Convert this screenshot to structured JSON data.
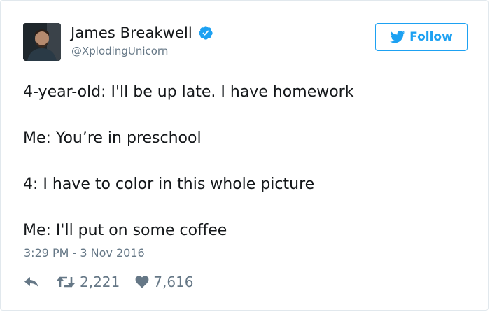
{
  "user": {
    "name": "James Breakwell",
    "handle": "@XplodingUnicorn",
    "verified": true
  },
  "follow_button": {
    "label": "Follow"
  },
  "tweet": {
    "lines": [
      "4-year-old: I'll be up late. I have homework",
      "Me: You’re in preschool",
      "4: I have to color in this whole picture",
      "Me: I'll put on some coffee"
    ],
    "timestamp": "3:29 PM - 3 Nov 2016"
  },
  "actions": {
    "retweets": "2,221",
    "likes": "7,616"
  },
  "colors": {
    "brand_blue": "#1da1f2",
    "text_primary": "#14171a",
    "text_secondary": "#657786",
    "border": "#e1e8ed"
  },
  "icons": {
    "verified": "verified-badge-icon",
    "follow": "twitter-bird-icon",
    "reply": "reply-arrow-icon",
    "retweet": "retweet-icon",
    "like": "heart-icon"
  }
}
